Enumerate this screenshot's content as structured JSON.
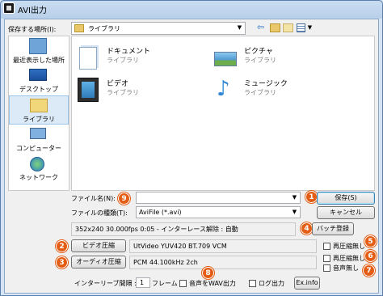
{
  "window": {
    "title": "AVI出力"
  },
  "toolbar": {
    "save_in_label": "保存する場所(I):",
    "location": "ライブラリ"
  },
  "places": [
    {
      "label": "最近表示した場所"
    },
    {
      "label": "デスクトップ"
    },
    {
      "label": "ライブラリ"
    },
    {
      "label": "コンピューター"
    },
    {
      "label": "ネットワーク"
    }
  ],
  "libraries": [
    {
      "name": "ドキュメント",
      "sub": "ライブラリ"
    },
    {
      "name": "ピクチャ",
      "sub": "ライブラリ"
    },
    {
      "name": "ビデオ",
      "sub": "ライブラリ"
    },
    {
      "name": "ミュージック",
      "sub": "ライブラリ"
    }
  ],
  "file": {
    "name_label": "ファイル名(N):",
    "name_value": "",
    "type_label": "ファイルの種類(T):",
    "type_value": "AviFile (*.avi)",
    "save_button": "保存(S)",
    "cancel_button": "キャンセル"
  },
  "info": {
    "text": "352x240  30.000fps  0:05  -  インターレース解除 : 自動",
    "batch_button": "バッチ登録"
  },
  "video": {
    "button": "ビデオ圧縮",
    "codec": "UtVideo YUV420 BT.709 VCM",
    "recompress_label": "再圧縮無し"
  },
  "audio": {
    "button": "オーディオ圧縮",
    "codec": "PCM 44.100kHz 2ch",
    "recompress_label": "再圧縮無し",
    "no_audio_label": "音声無し"
  },
  "bottom": {
    "interleave_label": "インターリーブ間隔 :",
    "interleave_value": "1",
    "interleave_unit": "フレーム",
    "wav_label": "音声をWAV出力",
    "log_label": "ログ出力",
    "exinfo_button": "Ex.info"
  },
  "badges": {
    "b1": "1",
    "b4": "4",
    "b2": "2",
    "b3": "3",
    "b5": "5",
    "b6": "6",
    "b7": "7",
    "b8": "8",
    "b9": "9"
  },
  "colors": {
    "badge": "#e45d14",
    "accent": "#3c7fb1",
    "titlebar": "#b9d0ea"
  }
}
